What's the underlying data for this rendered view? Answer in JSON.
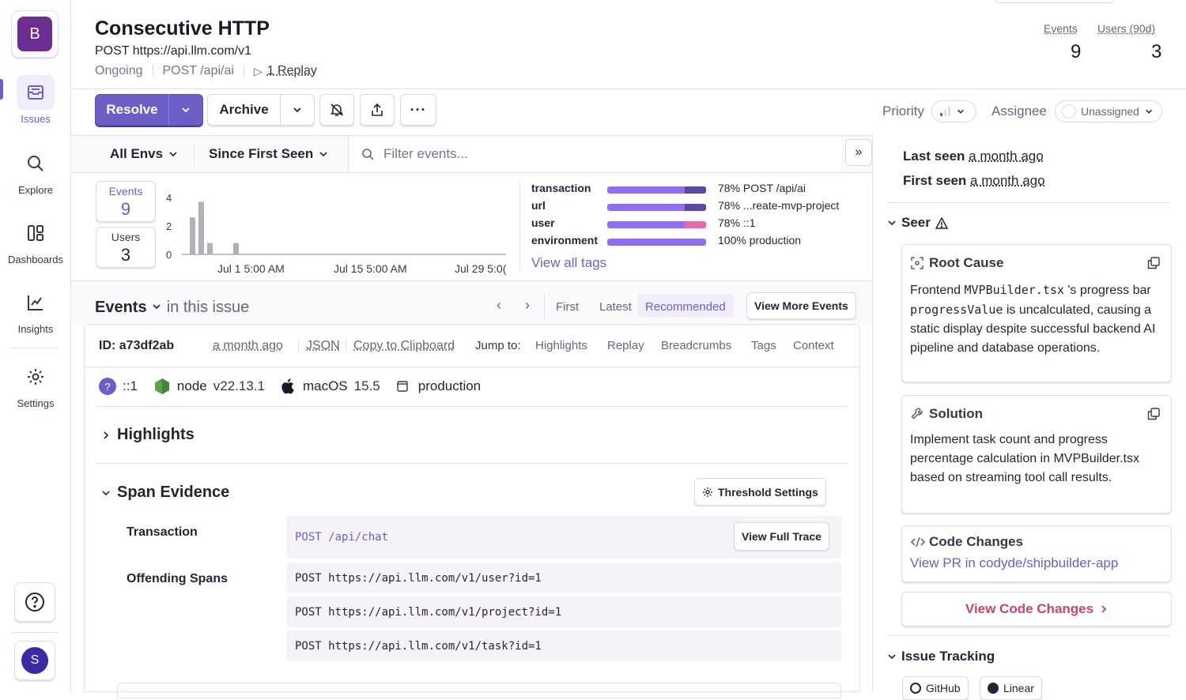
{
  "org": {
    "initial": "B"
  },
  "nav": {
    "issues": "Issues",
    "explore": "Explore",
    "dashboards": "Dashboards",
    "insights": "Insights",
    "settings": "Settings"
  },
  "user": {
    "initial": "S"
  },
  "issue": {
    "title": "Consecutive HTTP",
    "subtitle": "POST https://api.llm.com/v1",
    "status": "Ongoing",
    "culprit": "POST /api/ai",
    "replay": "1 Replay"
  },
  "header_stats": {
    "events_label": "Events",
    "events_value": "9",
    "users_label": "Users (90d)",
    "users_value": "3"
  },
  "actions": {
    "resolve": "Resolve",
    "archive": "Archive",
    "priority_label": "Priority",
    "assignee_label": "Assignee",
    "assignee_value": "Unassigned"
  },
  "filters": {
    "env": "All Envs",
    "time": "Since First Seen",
    "search_placeholder": "Filter events..."
  },
  "summary": {
    "events_label": "Events",
    "events_value": "9",
    "users_label": "Users",
    "users_value": "3"
  },
  "chart_data": {
    "type": "bar",
    "x": [
      "Jul 1 5:00 AM",
      "Jul 15 5:00 AM",
      "Jul 29 5:0("
    ],
    "y_ticks": [
      "0",
      "2",
      "4"
    ],
    "ylim": [
      0,
      4
    ],
    "values": [
      2.6,
      3.7,
      0.8,
      0.8
    ],
    "grid": false
  },
  "tags": [
    {
      "key": "transaction",
      "value": "78% POST /api/ai",
      "pct": 0.78,
      "color2": "#5c4a9e"
    },
    {
      "key": "url",
      "value": "78%  ...reate-mvp-project",
      "pct": 0.78,
      "color2": "#5c4a9e"
    },
    {
      "key": "user",
      "value": "78% ::1",
      "pct": 0.78,
      "color2": "#e26aa8"
    },
    {
      "key": "environment",
      "value": "100% production",
      "pct": 1.0,
      "color2": "#8d6ff0"
    }
  ],
  "view_all_tags": "View all tags",
  "events_section": {
    "title": "Events",
    "subtitle": "in this issue",
    "first": "First",
    "latest": "Latest",
    "recommended": "Recommended",
    "view_more": "View More Events"
  },
  "event": {
    "id": "ID: a73df2ab",
    "time": "a month ago",
    "json": "JSON",
    "copy": "Copy to Clipboard",
    "jump_to": "Jump to:",
    "jumps": [
      "Highlights",
      "Replay",
      "Breadcrumbs",
      "Tags",
      "Context"
    ],
    "ctx_user": "::1",
    "ctx_runtime": "node",
    "ctx_runtime_ver": "v22.13.1",
    "ctx_os": "macOS",
    "ctx_os_ver": "15.5",
    "ctx_env": "production"
  },
  "highlights_title": "Highlights",
  "span_evidence": {
    "title": "Span Evidence",
    "threshold_btn": "Threshold Settings",
    "transaction_label": "Transaction",
    "transaction_value": "POST /api/chat",
    "view_trace": "View Full Trace",
    "offending_label": "Offending Spans",
    "spans": [
      "POST https://api.llm.com/v1/user?id=1",
      "POST https://api.llm.com/v1/project?id=1",
      "POST https://api.llm.com/v1/task?id=1"
    ]
  },
  "sidebar_right": {
    "last_seen_label": "Last seen",
    "last_seen": "a month ago",
    "first_seen_label": "First seen",
    "first_seen": "a month ago",
    "seer_title": "Seer",
    "root_cause_title": "Root Cause",
    "root_cause_pre": "Frontend ",
    "root_cause_code1": "MVPBuilder.tsx",
    "root_cause_mid": " 's progress bar ",
    "root_cause_code2": "progressValue",
    "root_cause_post": " is uncalculated, causing a static display despite successful backend AI pipeline and database operations.",
    "solution_title": "Solution",
    "solution_body": "Implement task count and progress percentage calculation in MVPBuilder.tsx based on streaming tool call results.",
    "code_changes_title": "Code Changes",
    "code_changes_link": "View PR in codyde/shipbuilder-app",
    "view_code_changes": "View Code Changes",
    "issue_tracking_title": "Issue Tracking",
    "github": "GitHub",
    "linear": "Linear"
  }
}
